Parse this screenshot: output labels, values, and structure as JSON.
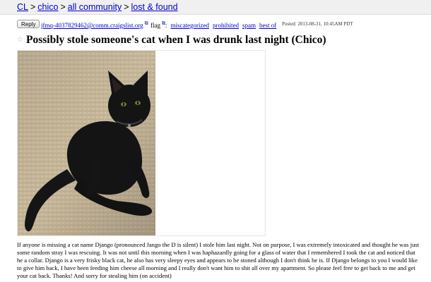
{
  "breadcrumbs": [
    {
      "label": "CL"
    },
    {
      "label": "chico"
    },
    {
      "label": "all community"
    },
    {
      "label": "lost & found"
    }
  ],
  "breadcrumb_separator": ">",
  "postbar": {
    "reply_label": "Reply",
    "reply_email": "jfmq-4037829462@comm.craigslist.org",
    "flag_label": "flag",
    "flag_suffix": ":",
    "flag_links": [
      "miscategorized",
      "prohibited",
      "spam",
      "best of"
    ],
    "posted": "Posted: 2013-08-31, 10:45AM PDT"
  },
  "post": {
    "title": "Possibly stole someone's cat when I was drunk last night (Chico)",
    "body": "If anyone is missing a cat name Django (pronounced Jango the D is silent) I stole him last night. Not on purpose, I was extremely intoxicated and thought he was just some random stray I was rescuing. It was not until this morning when I was haphazardly going for a glass of water that I remembered I took the cat and noticed that he a collar. Django is a very frisky black cat, he also has very sleepy eyes and appears to be stoned although I don't think he is. If Django belongs to you I would like to give him back, I have been feeding him cheese all morning and I really don't want him to shit all over my apartment. So please feel free to get back to me and get your cat back. Thanks! And sorry for stealing him (on accident)"
  },
  "icons": {
    "star": "star-icon",
    "external": "external-link-icon"
  },
  "colors": {
    "link": "#0000cc",
    "topbar": "#f0f0f0",
    "carpet": "#c9b89c",
    "cat": "#141414"
  }
}
